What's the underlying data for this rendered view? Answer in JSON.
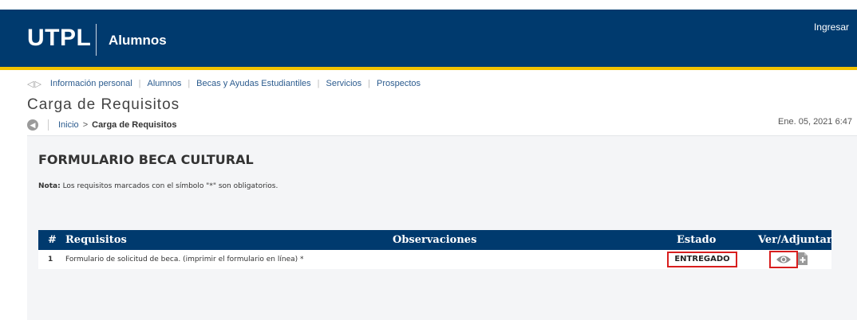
{
  "header": {
    "logo_main": "UTPL",
    "logo_sub": "Alumnos",
    "login_label": "Ingresar"
  },
  "nav": {
    "items": [
      "Información personal",
      "Alumnos",
      "Becas y Ayudas Estudiantiles",
      "Servicios",
      "Prospectos"
    ]
  },
  "page": {
    "title": "Carga de Requisitos",
    "breadcrumb_home": "Inicio",
    "breadcrumb_separator": ">",
    "breadcrumb_current": "Carga de Requisitos",
    "datetime": "Ene. 05, 2021 6:47"
  },
  "form": {
    "title": "FORMULARIO BECA CULTURAL",
    "note_label": "Nota:",
    "note_text": " Los requisitos marcados con el símbolo \"*\" son obligatorios."
  },
  "table": {
    "headers": {
      "num": "#",
      "requisitos": "Requisitos",
      "observaciones": "Observaciones",
      "estado": "Estado",
      "ver_adjuntar": "Ver/Adjuntar"
    },
    "rows": [
      {
        "num": "1",
        "requisito": "Formulario de solicitud de beca. (imprimir el formulario en línea) *",
        "observaciones": "",
        "estado": "ENTREGADO"
      }
    ]
  },
  "icons": {
    "back": "back-arrow-icon",
    "view": "eye-icon",
    "attach": "attach-file-icon"
  },
  "colors": {
    "header_bg": "#003a6e",
    "accent_gold": "#f2c200",
    "highlight_red": "#d81e1e"
  }
}
